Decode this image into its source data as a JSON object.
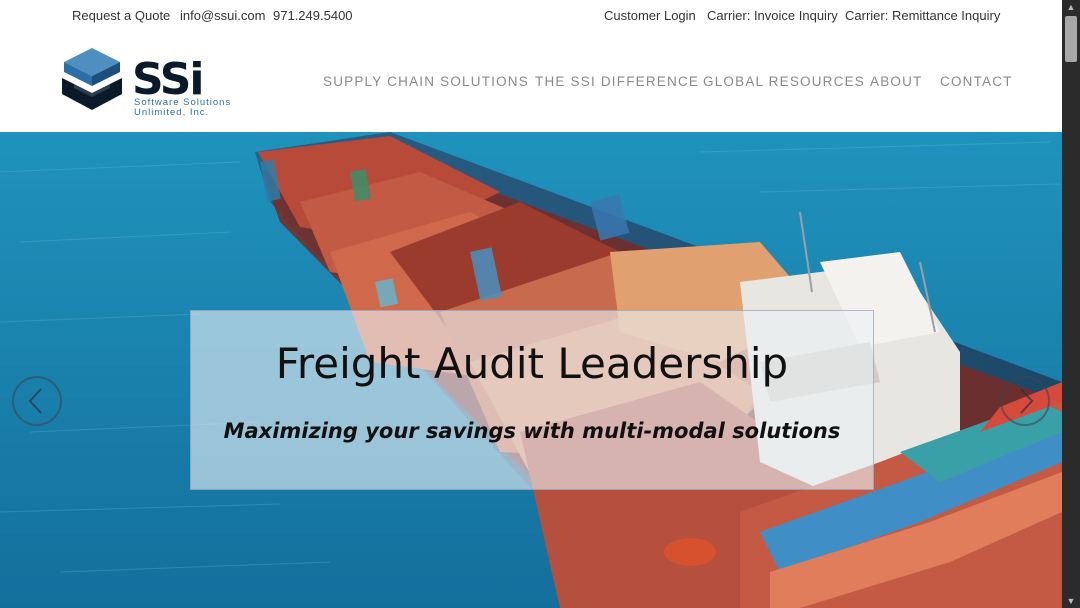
{
  "topbar": {
    "request_quote": "Request a Quote",
    "email": "info@ssui.com",
    "phone": "971.249.5400",
    "customer_login": "Customer Login",
    "invoice_inquiry": "Carrier: Invoice Inquiry",
    "remittance_inquiry": "Carrier: Remittance Inquiry"
  },
  "logo": {
    "wordmark": "SSi",
    "sub_line1": "Software Solutions",
    "sub_line2": "Unlimited, Inc."
  },
  "nav": {
    "items": [
      "SUPPLY CHAIN SOLUTIONS",
      "THE SSI DIFFERENCE",
      "GLOBAL RESOURCES",
      "ABOUT",
      "CONTACT"
    ]
  },
  "hero": {
    "title": "Freight Audit Leadership",
    "subtitle": "Maximizing your savings with multi-modal solutions"
  },
  "colors": {
    "sea": "#1e86b3",
    "nav_text": "#8a8a8a",
    "logo_dark": "#0b1a2a",
    "logo_blue": "#2c6fa8"
  }
}
